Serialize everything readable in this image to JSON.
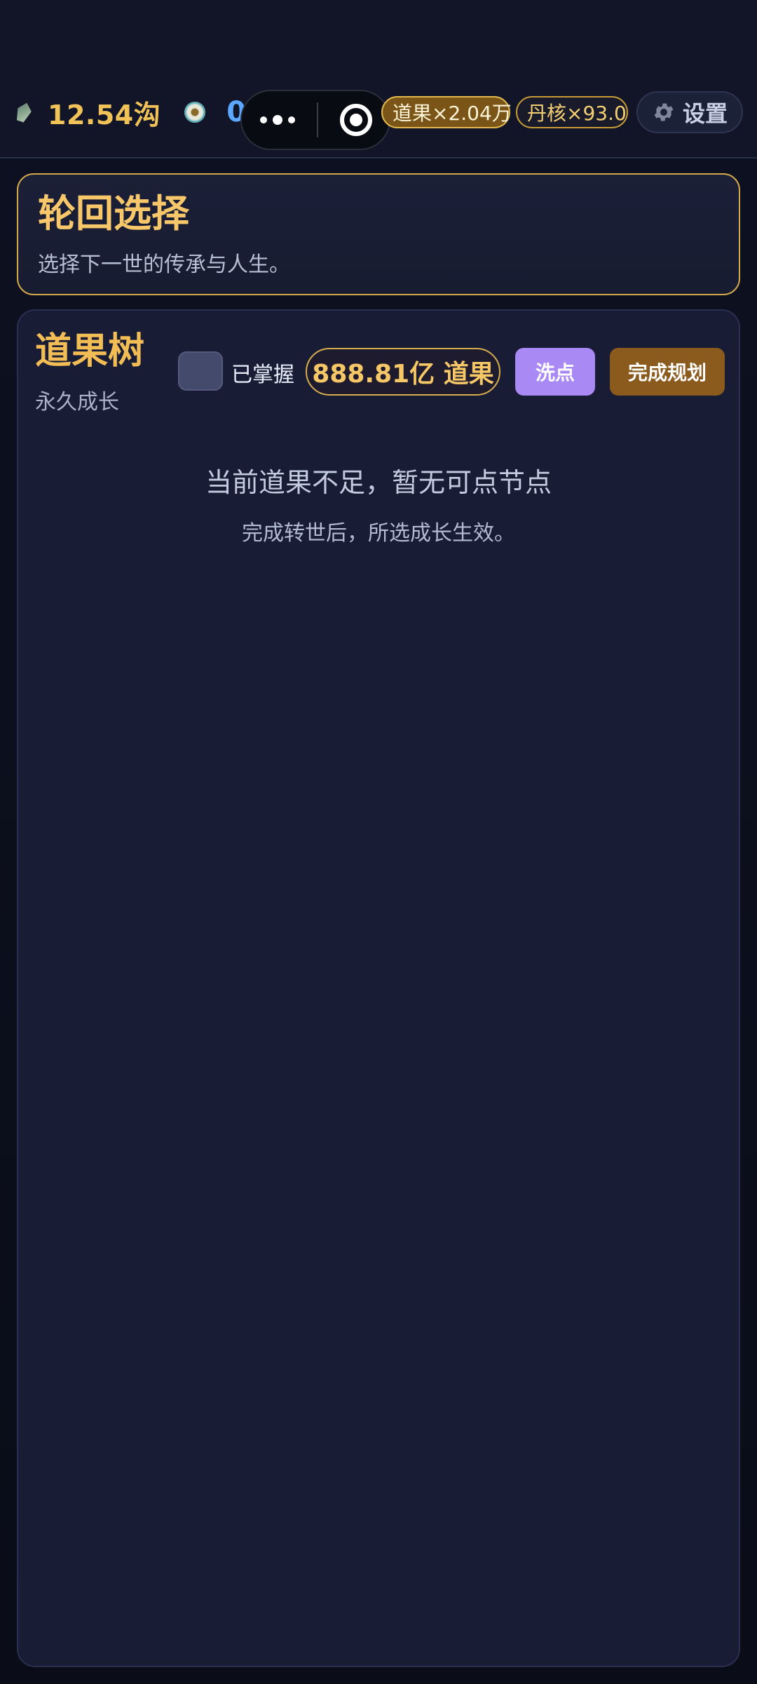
{
  "topbar": {
    "spirit_stone": "12.54沟",
    "eye_count": "0",
    "chips": {
      "daoguo_multiplier": "道果×2.04万",
      "danhe_multiplier": "丹核×93.0"
    },
    "settings_label": "设置"
  },
  "banner": {
    "title": "轮回选择",
    "subtitle": "选择下一世的传承与人生。"
  },
  "tree": {
    "title": "道果树",
    "subtitle": "永久成长",
    "toggle_label": "已掌握",
    "points": "888.81亿 道果",
    "wash_label": "洗点",
    "finish_label": "完成规划",
    "empty_title": "当前道果不足，暂无可点节点",
    "empty_subtitle": "完成转世后，所选成长生效。"
  },
  "colors": {
    "accent_gold": "#f3bd56",
    "accent_purple": "#a98af4",
    "accent_brown": "#8a5b1d",
    "accent_blue": "#5aa8ff",
    "card_bg": "#181c35"
  },
  "icons": [
    "gem-icon",
    "eye-icon",
    "more-dots-icon",
    "target-icon",
    "gear-icon"
  ]
}
